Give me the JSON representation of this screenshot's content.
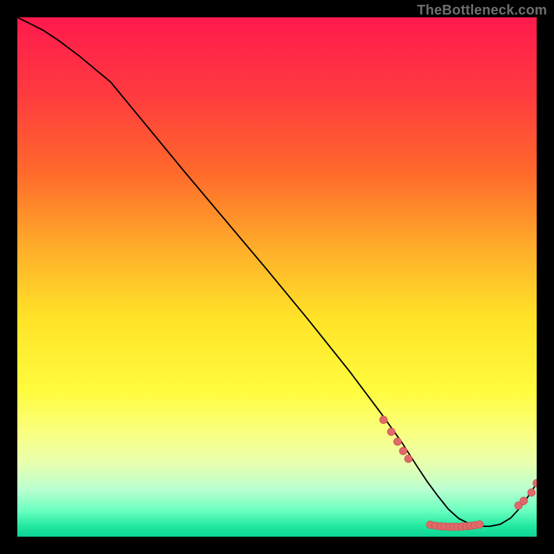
{
  "watermark": "TheBottleneck.com",
  "colors": {
    "background": "#000000",
    "gradient_stops": [
      {
        "offset": 0.0,
        "color": "#ff1a4d"
      },
      {
        "offset": 0.15,
        "color": "#ff3b3f"
      },
      {
        "offset": 0.3,
        "color": "#ff6a2b"
      },
      {
        "offset": 0.45,
        "color": "#ffb02a"
      },
      {
        "offset": 0.58,
        "color": "#ffe328"
      },
      {
        "offset": 0.72,
        "color": "#fffc3e"
      },
      {
        "offset": 0.8,
        "color": "#f9ff80"
      },
      {
        "offset": 0.86,
        "color": "#e8ffb0"
      },
      {
        "offset": 0.91,
        "color": "#b8ffd0"
      },
      {
        "offset": 0.95,
        "color": "#6affc0"
      },
      {
        "offset": 0.98,
        "color": "#22e8a0"
      },
      {
        "offset": 1.0,
        "color": "#0cd494"
      }
    ],
    "curve": "#000000",
    "marker_fill": "#e06a6a",
    "marker_stroke": "#c94f4f"
  },
  "chart_data": {
    "type": "line",
    "title": "",
    "xlabel": "",
    "ylabel": "",
    "xlim": [
      0,
      100
    ],
    "ylim": [
      0,
      100
    ],
    "curve": {
      "x": [
        0,
        2,
        5,
        8,
        12,
        18,
        25,
        32,
        40,
        48,
        56,
        64,
        70,
        74,
        77,
        79,
        81,
        83,
        85,
        87,
        89,
        91,
        93,
        95,
        97,
        99,
        100
      ],
      "y": [
        100,
        99,
        97.5,
        95.5,
        92.5,
        87.5,
        79.0,
        70.5,
        61.0,
        51.5,
        41.8,
        31.8,
        23.8,
        18.2,
        13.5,
        10.5,
        7.8,
        5.3,
        3.5,
        2.5,
        2.0,
        2.0,
        2.4,
        3.6,
        5.8,
        8.7,
        10.3
      ]
    },
    "markers": [
      {
        "x": 70.5,
        "y": 22.5
      },
      {
        "x": 72.0,
        "y": 20.2
      },
      {
        "x": 73.2,
        "y": 18.3
      },
      {
        "x": 74.3,
        "y": 16.5
      },
      {
        "x": 75.3,
        "y": 15.0
      },
      {
        "x": 79.5,
        "y": 2.3
      },
      {
        "x": 80.5,
        "y": 2.1
      },
      {
        "x": 81.5,
        "y": 2.0
      },
      {
        "x": 82.3,
        "y": 1.95
      },
      {
        "x": 83.2,
        "y": 1.9
      },
      {
        "x": 84.0,
        "y": 1.9
      },
      {
        "x": 84.8,
        "y": 1.9
      },
      {
        "x": 85.6,
        "y": 1.95
      },
      {
        "x": 86.5,
        "y": 2.0
      },
      {
        "x": 87.3,
        "y": 2.1
      },
      {
        "x": 88.1,
        "y": 2.2
      },
      {
        "x": 89.0,
        "y": 2.35
      },
      {
        "x": 96.5,
        "y": 6.0
      },
      {
        "x": 97.5,
        "y": 6.9
      },
      {
        "x": 99.0,
        "y": 8.5
      },
      {
        "x": 100.0,
        "y": 10.3
      }
    ]
  }
}
